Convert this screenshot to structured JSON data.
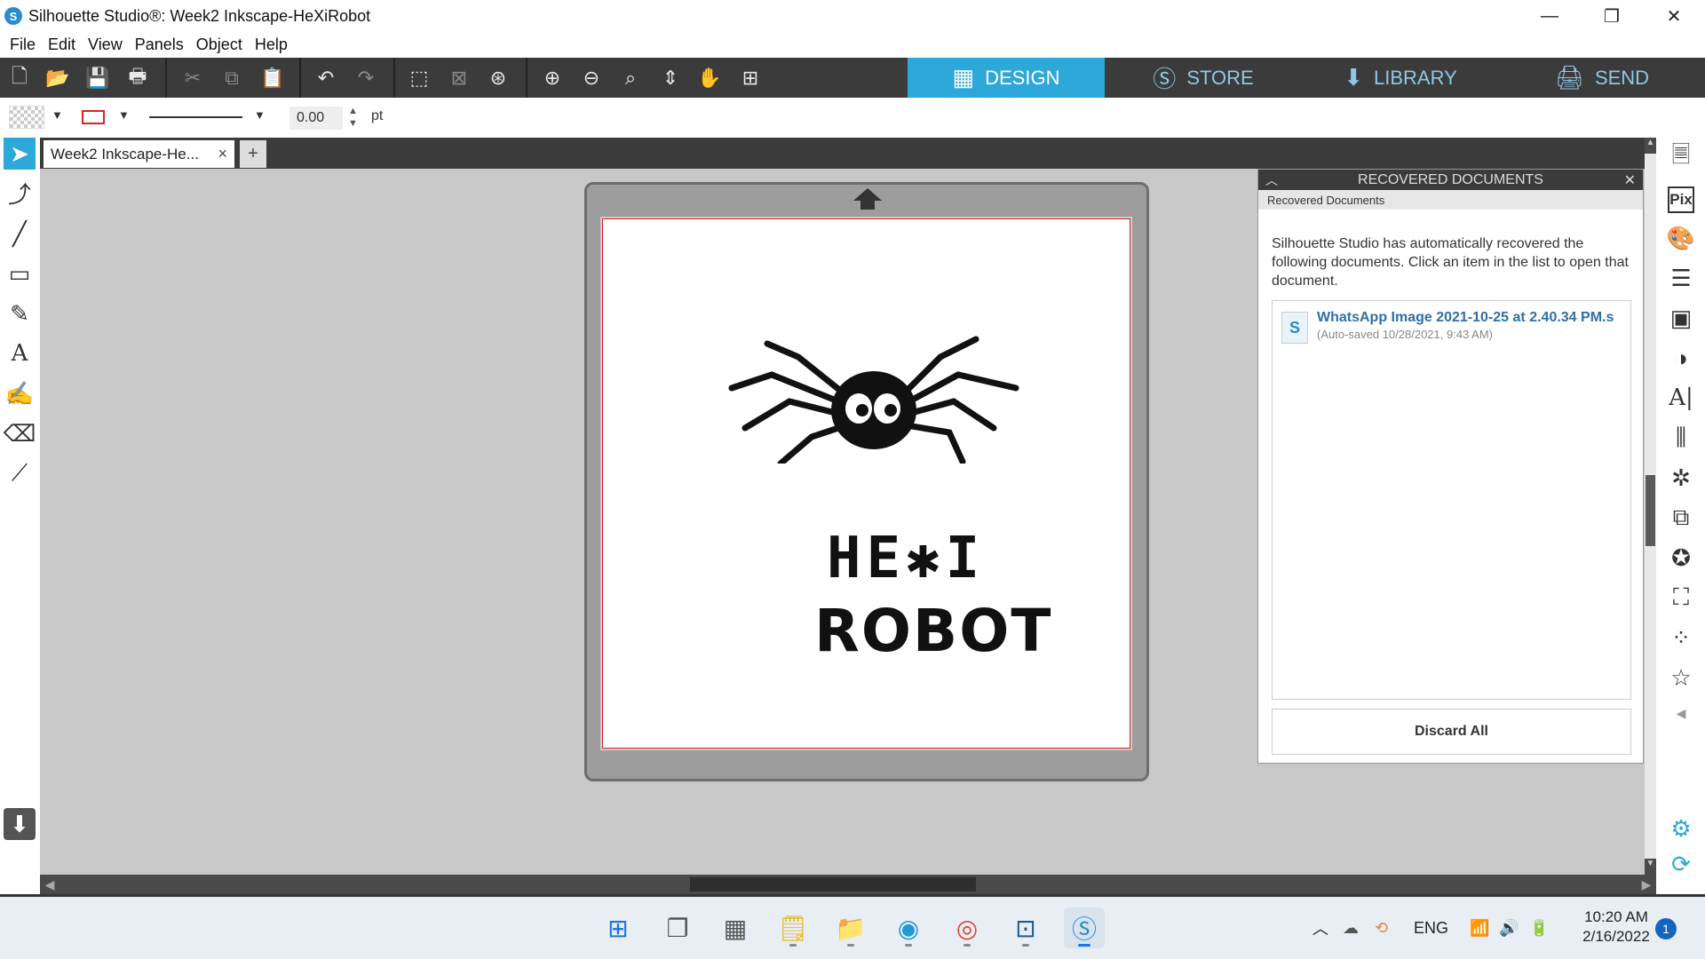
{
  "window": {
    "title": "Silhouette Studio®: Week2 Inkscape-HeXiRobot",
    "controls": [
      "—",
      "❐",
      "✕"
    ]
  },
  "menu": [
    "File",
    "Edit",
    "View",
    "Panels",
    "Object",
    "Help"
  ],
  "nav_tabs": [
    {
      "label": "DESIGN",
      "icon": "grid-icon",
      "active": true
    },
    {
      "label": "STORE",
      "icon": "silhouette-s-icon",
      "active": false
    },
    {
      "label": "LIBRARY",
      "icon": "download-box-icon",
      "active": false
    },
    {
      "label": "SEND",
      "icon": "cutter-icon",
      "active": false
    }
  ],
  "properties": {
    "line_width": "0.00",
    "line_unit": "pt"
  },
  "document_tab": {
    "label": "Week2 Inkscape-He...",
    "close": "×",
    "add": "+"
  },
  "canvas": {
    "design_line1": "HE✱I",
    "design_line2": "ROBOT"
  },
  "recovered_panel": {
    "header": "RECOVERED DOCUMENTS",
    "subheader": "Recovered Documents",
    "description": "Silhouette Studio has automatically recovered the following documents. Click an item in the list to open that document.",
    "items": [
      {
        "name": "WhatsApp Image 2021-10-25 at 2.40.34 PM.s",
        "saved": "(Auto-saved 10/28/2021, 9:43 AM)"
      }
    ],
    "discard_label": "Discard All"
  },
  "taskbar": {
    "language": "ENG",
    "time": "10:20 AM",
    "date": "2/16/2022",
    "notifications": "1"
  },
  "colors": {
    "toolbar": "#3b3b3b",
    "active_tab": "#2ea7d9",
    "inactive_tab_text": "#8fc8e4",
    "page_border": "#dd2222"
  }
}
